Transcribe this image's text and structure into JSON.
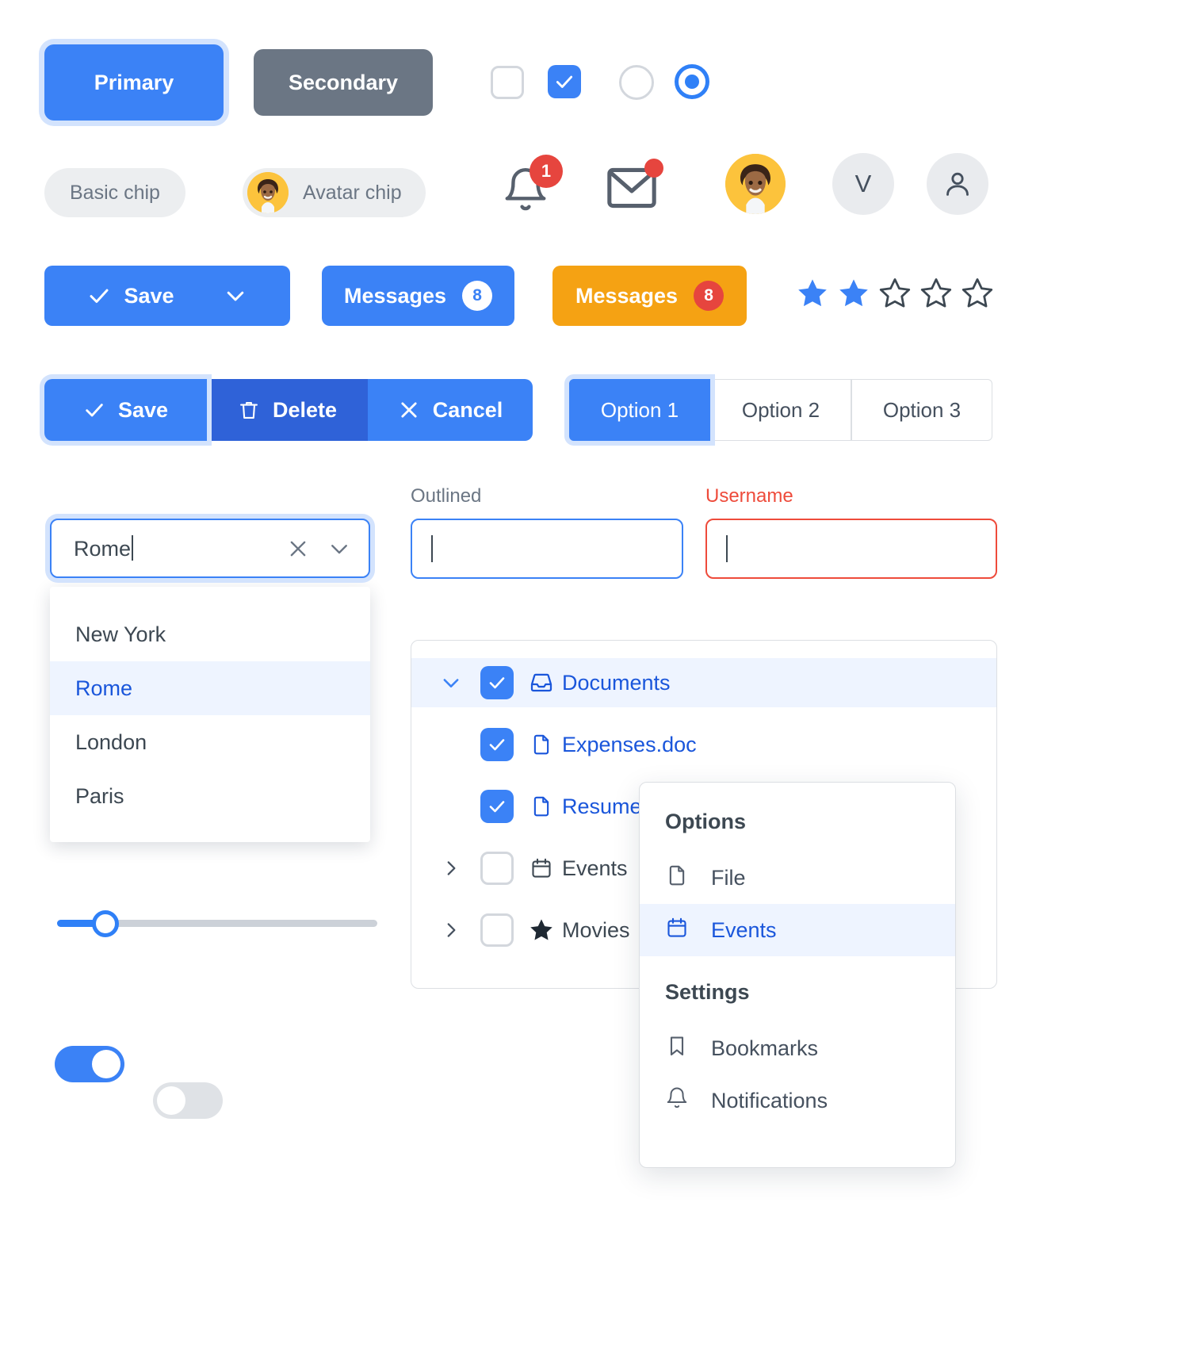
{
  "buttons": {
    "primary": "Primary",
    "secondary": "Secondary"
  },
  "selection_controls": {
    "checkbox_unchecked": "checkbox-unchecked",
    "checkbox_checked": "checkbox-checked",
    "radio_unselected": "radio-unselected",
    "radio_selected": "radio-selected"
  },
  "chips": {
    "basic": "Basic chip",
    "avatar": "Avatar chip"
  },
  "icons_row": {
    "bell_badge": "1",
    "mail_badge_dot": true,
    "initial_avatar": "V",
    "person_avatar": "person-icon"
  },
  "action_buttons": {
    "save": "Save",
    "messages_blue": "Messages",
    "messages_blue_count": "8",
    "messages_orange": "Messages",
    "messages_orange_count": "8"
  },
  "rating": {
    "filled": 2,
    "total": 5
  },
  "button_group": {
    "save": "Save",
    "delete": "Delete",
    "cancel": "Cancel"
  },
  "segmented": {
    "options": [
      "Option 1",
      "Option 2",
      "Option 3"
    ],
    "selected_index": 0
  },
  "combobox": {
    "value": "Rome",
    "options": [
      "New York",
      "Rome",
      "London",
      "Paris"
    ],
    "highlighted": "Rome"
  },
  "text_fields": [
    {
      "label": "Outlined",
      "value": "",
      "state": "focused"
    },
    {
      "label": "Username",
      "value": "",
      "state": "error"
    }
  ],
  "slider": {
    "value_percent": 15
  },
  "toggles": {
    "on": "toggle-on",
    "off": "toggle-off"
  },
  "tree": [
    {
      "label": "Documents",
      "icon": "inbox-icon",
      "checked": true,
      "expanded": true,
      "has_chevron": true,
      "selected": true,
      "indent": 0
    },
    {
      "label": "Expenses.doc",
      "icon": "file-icon",
      "checked": true,
      "expanded": false,
      "has_chevron": false,
      "selected": false,
      "indent": 1
    },
    {
      "label": "Resume.doc",
      "icon": "file-icon",
      "checked": true,
      "expanded": false,
      "has_chevron": false,
      "selected": false,
      "indent": 1
    },
    {
      "label": "Events",
      "icon": "calendar-icon",
      "checked": false,
      "expanded": false,
      "has_chevron": true,
      "selected": false,
      "indent": 0
    },
    {
      "label": "Movies",
      "icon": "star-icon",
      "checked": false,
      "expanded": false,
      "has_chevron": true,
      "selected": false,
      "indent": 0
    }
  ],
  "menu": {
    "group_options": "Options",
    "group_settings": "Settings",
    "items_options": [
      {
        "label": "File",
        "icon": "file-icon",
        "selected": false
      },
      {
        "label": "Events",
        "icon": "calendar-icon",
        "selected": true
      }
    ],
    "items_settings": [
      {
        "label": "Bookmarks",
        "icon": "bookmark-icon",
        "selected": false
      },
      {
        "label": "Notifications",
        "icon": "bell-icon",
        "selected": false
      }
    ]
  },
  "colors": {
    "primary": "#3b82f6",
    "primary_dark": "#2f62d8",
    "secondary": "#6b7684",
    "warning": "#f5a213",
    "danger": "#e6453e",
    "error": "#ee4b3b",
    "link": "#1a56db",
    "focus_ring": "#d3e3fd",
    "selected_bg": "#eef4ff"
  }
}
